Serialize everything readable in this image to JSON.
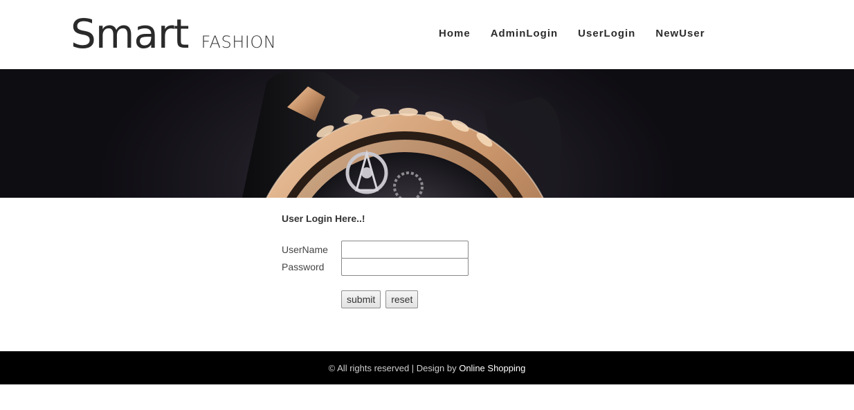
{
  "logo": {
    "main": "Smart",
    "sub": "FASHION"
  },
  "nav": {
    "items": [
      "Home",
      "AdminLogin",
      "UserLogin",
      "NewUser"
    ]
  },
  "login": {
    "title": "User Login Here..!",
    "username_label": "UserName",
    "username_value": "",
    "password_label": "Password",
    "password_value": "",
    "submit_label": "submit",
    "reset_label": "reset"
  },
  "footer": {
    "text": "© All rights reserved | Design by",
    "link": "Online Shopping"
  },
  "colors": {
    "footer_bg": "#000000",
    "text": "#333333",
    "banner_dark": "#1d1a22",
    "watch_gold": "#c9946a"
  },
  "banner": {
    "icon": "watch-banner-image"
  }
}
